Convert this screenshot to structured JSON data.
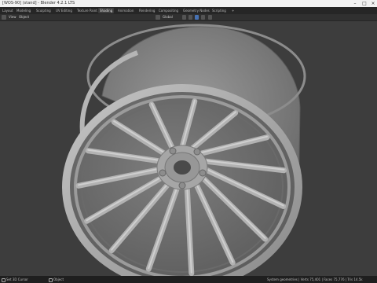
{
  "window": {
    "title": "[WOS-90] (stand] - Blender 4.2.1 LTS"
  },
  "workspace_tabs": [
    {
      "label": "Layout"
    },
    {
      "label": "Modeling"
    },
    {
      "label": "Sculpting"
    },
    {
      "label": "UV Editing"
    },
    {
      "label": "Texture Paint"
    },
    {
      "label": "Shading",
      "active": true
    },
    {
      "label": "Animation"
    },
    {
      "label": "Rendering"
    },
    {
      "label": "Compositing"
    },
    {
      "label": "Geometry Nodes"
    },
    {
      "label": "Scripting"
    }
  ],
  "scene": {
    "label": "Scene"
  },
  "header": {
    "view": "View",
    "object": "Object",
    "orientation": "Global"
  },
  "status": {
    "left": "Set 3D Cursor",
    "mid": "Object",
    "right": "System geometries | Verts 75,401 | Faces 75,776 | Tris 14.5k"
  },
  "colors": {
    "accent": "#4772b3",
    "viewport_bg": "#3d3d3d",
    "wheel": "#a8a8a8"
  },
  "icons": [
    "close-icon",
    "minimize-icon",
    "maximize-icon",
    "scene-icon",
    "cursor-icon",
    "object-icon"
  ]
}
